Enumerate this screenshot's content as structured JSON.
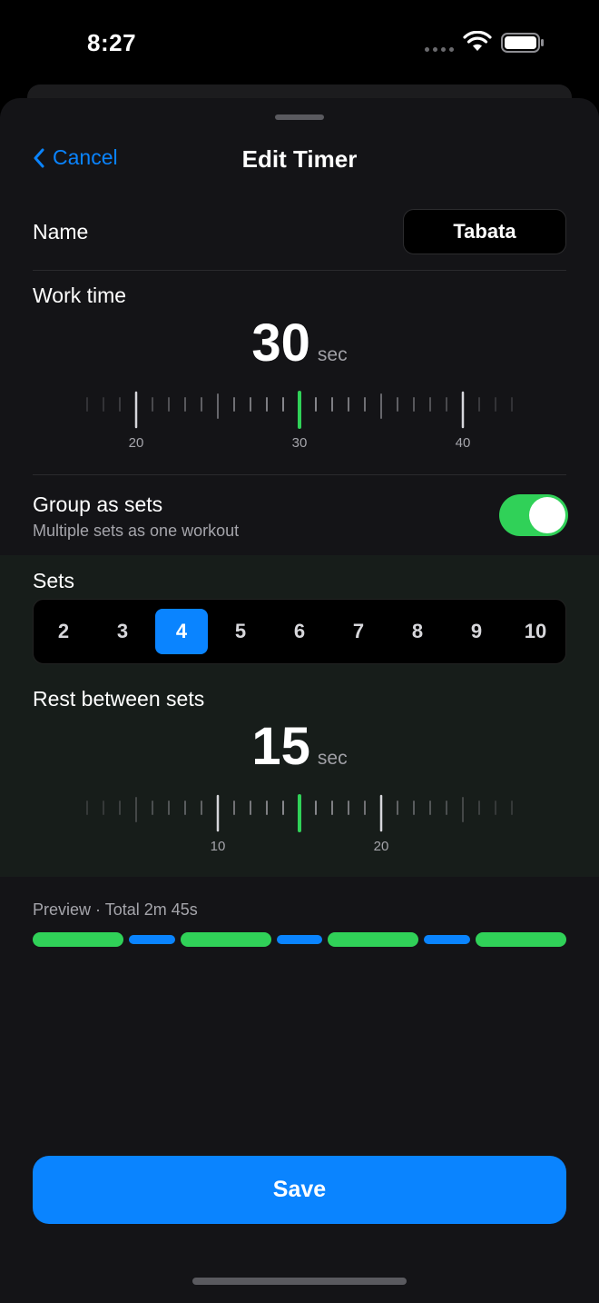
{
  "status_bar": {
    "time": "8:27"
  },
  "nav": {
    "cancel_label": "Cancel",
    "title": "Edit Timer"
  },
  "name_row": {
    "label": "Name",
    "value": "Tabata"
  },
  "work_time": {
    "label": "Work time",
    "value": "30",
    "unit": "sec",
    "ruler": {
      "min": 17,
      "max": 43,
      "selected": 30,
      "major_every": 10,
      "tick_labels": [
        "20",
        "30",
        "40"
      ]
    }
  },
  "group_sets": {
    "label": "Group as sets",
    "subtitle": "Multiple sets as one workout",
    "enabled": true
  },
  "sets": {
    "label": "Sets",
    "options": [
      "2",
      "3",
      "4",
      "5",
      "6",
      "7",
      "8",
      "9",
      "10"
    ],
    "selected": "4"
  },
  "rest": {
    "label": "Rest between sets",
    "value": "15",
    "unit": "sec",
    "ruler": {
      "min": 2,
      "max": 28,
      "selected": 15,
      "major_every": 10,
      "tick_labels": [
        "10",
        "20"
      ]
    }
  },
  "preview": {
    "label": "Preview · Total 2m 45s",
    "segments": [
      "work",
      "rest",
      "work",
      "rest",
      "work",
      "rest",
      "work"
    ]
  },
  "save_label": "Save",
  "colors": {
    "accent": "#0a84ff",
    "work": "#30d158",
    "rest": "#0a84ff",
    "background": "#141417"
  }
}
